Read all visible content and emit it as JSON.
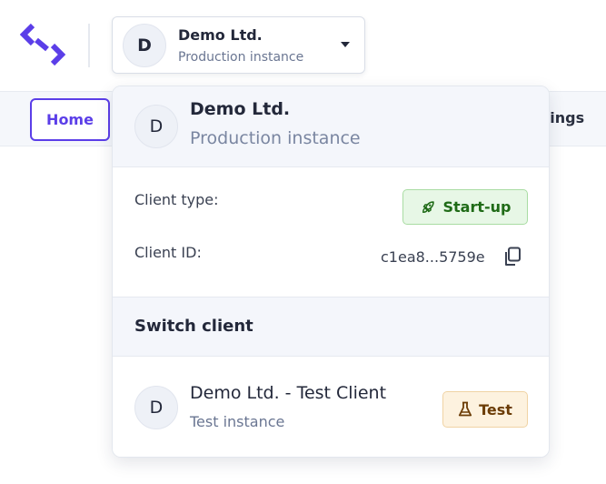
{
  "header": {
    "logo_icon": "brand-logo-icon",
    "brand_color": "#5b3ee8",
    "client_selector": {
      "avatar_initial": "D",
      "name": "Demo Ltd.",
      "subtitle": "Production instance",
      "caret_icon": "caret-down-icon"
    }
  },
  "nav": {
    "home_label": "Home",
    "settings_label": "ttings"
  },
  "dropdown": {
    "current": {
      "avatar_initial": "D",
      "name": "Demo Ltd.",
      "subtitle": "Production instance"
    },
    "client_type_label": "Client type:",
    "client_type_value": "Start-up",
    "client_type_icon": "rocket-icon",
    "client_id_label": "Client ID:",
    "client_id_value": "c1ea8...5759e",
    "copy_icon": "copy-icon",
    "switch_title": "Switch client",
    "clients": [
      {
        "avatar_initial": "D",
        "name": "Demo Ltd. - Test Client",
        "subtitle": "Test instance",
        "badge": "Test",
        "badge_icon": "flask-icon"
      }
    ]
  }
}
